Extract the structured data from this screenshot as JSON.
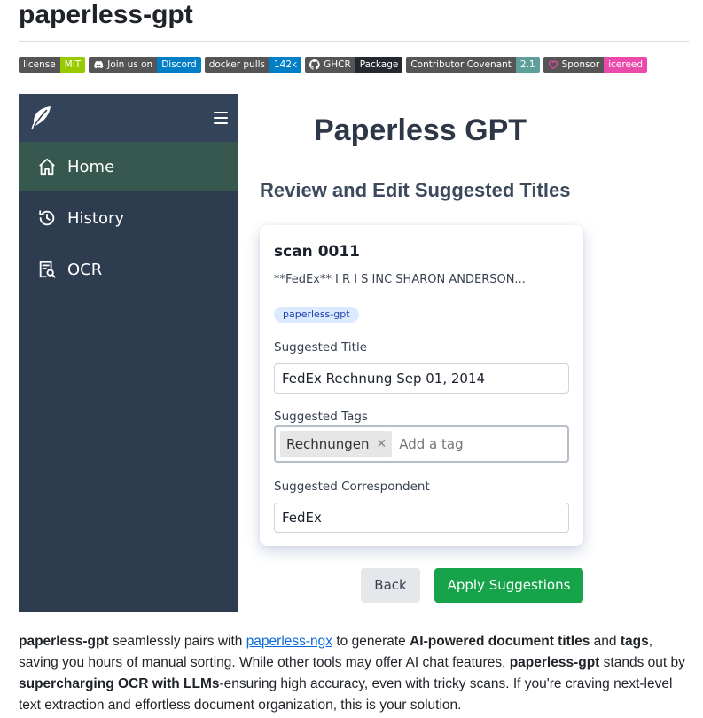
{
  "readme": {
    "title": "paperless-gpt"
  },
  "badges": [
    {
      "left": "license",
      "right": "MIT"
    },
    {
      "left": "Join us on",
      "right": "Discord"
    },
    {
      "left": "docker pulls",
      "right": "142k"
    },
    {
      "left": "GHCR",
      "right": "Package"
    },
    {
      "left": "Contributor Covenant",
      "right": "2.1"
    },
    {
      "left": "Sponsor",
      "right": "icereed"
    }
  ],
  "sidebar": {
    "items": [
      {
        "label": "Home",
        "icon": "home-icon",
        "active": true
      },
      {
        "label": "History",
        "icon": "history-icon",
        "active": false
      },
      {
        "label": "OCR",
        "icon": "ocr-icon",
        "active": false
      }
    ]
  },
  "main": {
    "app_title": "Paperless GPT",
    "section_title": "Review and Edit Suggested Titles",
    "card": {
      "title": "scan 0011",
      "snippet": "**FedEx** I R I S INC SHARON ANDERSON...",
      "tag": "paperless-gpt",
      "suggested_title_label": "Suggested Title",
      "suggested_title_value": "FedEx Rechnung Sep 01, 2014",
      "suggested_tags_label": "Suggested Tags",
      "tag_chip": "Rechnungen",
      "tag_placeholder": "Add a tag",
      "suggested_correspondent_label": "Suggested Correspondent",
      "suggested_correspondent_value": "FedEx"
    },
    "back_label": "Back",
    "apply_label": "Apply Suggestions"
  },
  "description": {
    "p1": "paperless-gpt",
    "p2": " seamlessly pairs with ",
    "link": "paperless-ngx",
    "p3": " to generate ",
    "p4": "AI-powered document titles",
    "p5": " and ",
    "p6": "tags",
    "p7": ", saving you hours of manual sorting. While other tools may offer AI chat features, ",
    "p8": "paperless-gpt",
    "p9": " stands out by ",
    "p10": "supercharging OCR with LLMs",
    "p11": "-ensuring high accuracy, even with tricky scans. If you're craving next-level text extraction and effortless document organization, this is your solution."
  },
  "colors": {
    "sidebar_bg": "#2d3c4f",
    "sidebar_active": "#36584f",
    "apply_green": "#16a34a",
    "link_blue": "#0969da"
  }
}
